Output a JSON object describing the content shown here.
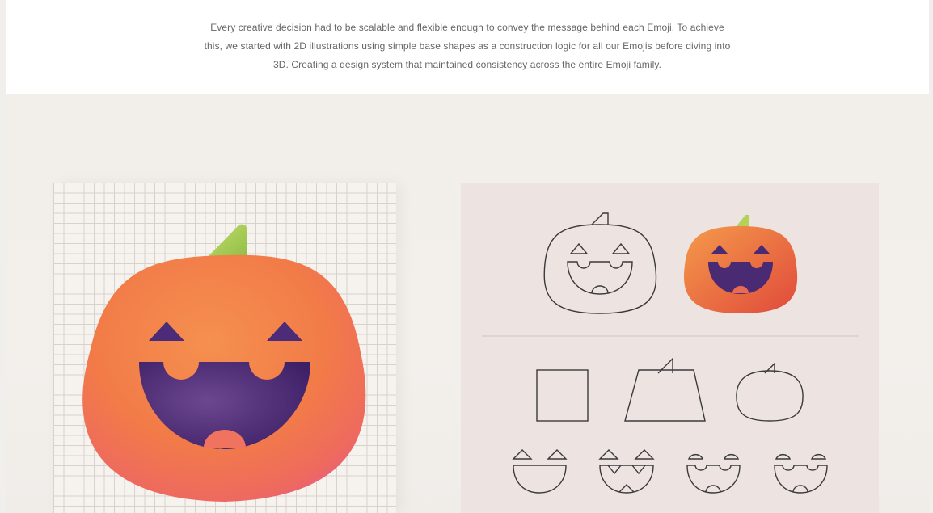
{
  "intro": {
    "text": "Every creative decision had to be scalable and flexible enough to convey the message behind each Emoji. To achieve this, we started with 2D illustrations using simple base shapes as a construction logic for all our Emojis before diving into 3D. Creating a design system that maintained consistency across the entire Emoji family."
  },
  "colors": {
    "pumpkin_orange": "#f07c45",
    "pumpkin_pink": "#ea5e6e",
    "stem_green": "#b4d25a",
    "mouth_purple": "#4a2a73",
    "outline": "#3a3a3a"
  },
  "icons": [
    "pumpkin-3d-icon",
    "pumpkin-outline-icon",
    "pumpkin-flat-icon",
    "square-shape-icon",
    "trapezoid-shape-icon",
    "rounded-pumpkin-shape-icon",
    "face-variant-icon"
  ]
}
